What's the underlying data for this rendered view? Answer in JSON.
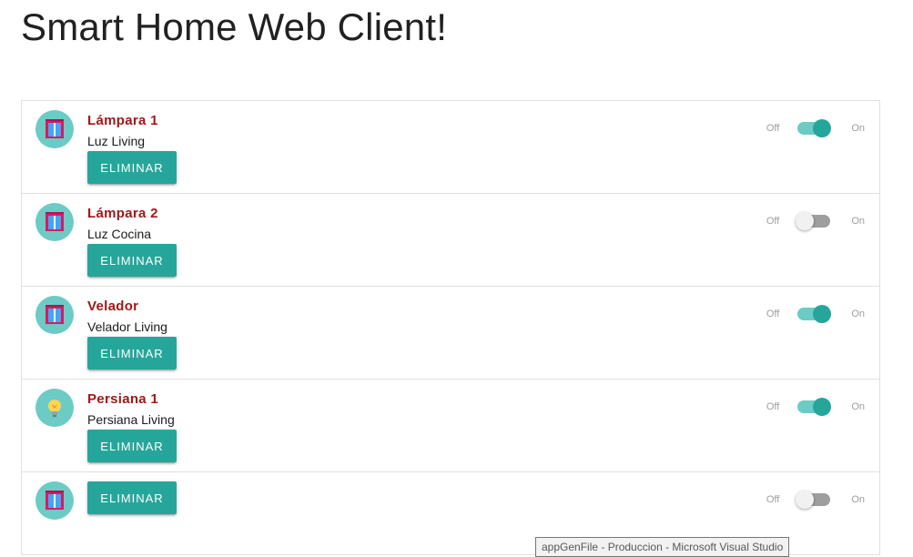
{
  "page": {
    "title": "Smart Home Web Client!"
  },
  "switch_labels": {
    "off": "Off",
    "on": "On"
  },
  "delete_label": "ELIMINAR",
  "devices": [
    {
      "name": "Lámpara 1",
      "description": "Luz Living",
      "icon": "window-icon",
      "state": "on"
    },
    {
      "name": "Lámpara 2",
      "description": "Luz Cocina",
      "icon": "window-icon",
      "state": "off"
    },
    {
      "name": "Velador",
      "description": "Velador Living",
      "icon": "window-icon",
      "state": "on"
    },
    {
      "name": "Persiana 1",
      "description": "Persiana Living",
      "icon": "lightbulb-icon",
      "state": "on"
    },
    {
      "name": "",
      "description": "",
      "icon": "window-icon",
      "state": "off"
    }
  ],
  "tooltip": {
    "text": "appGenFile - Produccion - Microsoft Visual Studio"
  },
  "colors": {
    "accent": "#26a69a",
    "avatar_bg": "#6ccbc4",
    "device_name": "#a01818"
  }
}
